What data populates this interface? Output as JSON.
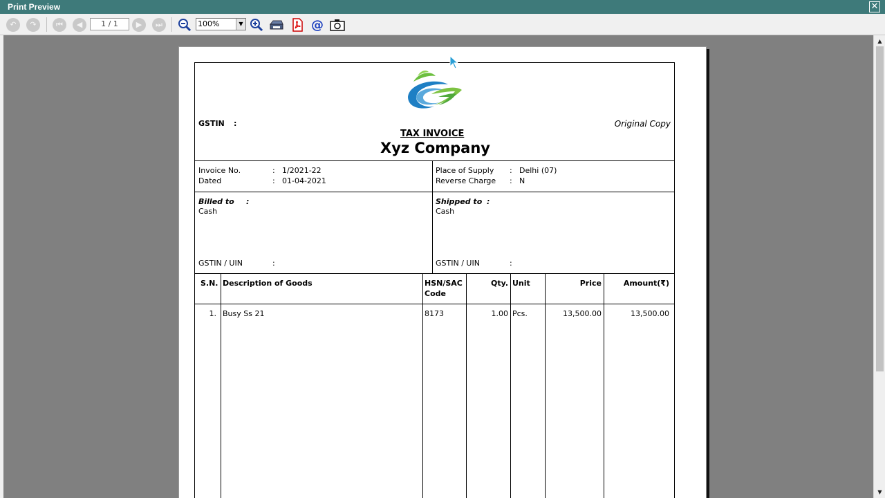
{
  "window": {
    "title": "Print Preview",
    "close_label": "✕"
  },
  "toolbar": {
    "page_indicator": "1 / 1",
    "zoom_value": "100%",
    "icons": [
      "undo-icon",
      "redo-icon",
      "first-page-icon",
      "previous-page-icon",
      "next-page-icon",
      "last-page-icon",
      "zoom-out-icon",
      "zoom-in-icon",
      "print-icon",
      "pdf-icon",
      "email-icon",
      "camera-icon"
    ]
  },
  "invoice": {
    "gstin_label": "GSTIN",
    "gstin_colon": ":",
    "copy_type": "Original Copy",
    "doc_title": "TAX INVOICE",
    "company_name": "Xyz Company",
    "invoice_no_label": "Invoice No.",
    "invoice_no": "1/2021-22",
    "dated_label": "Dated",
    "dated": "01-04-2021",
    "place_of_supply_label": "Place of Supply",
    "place_of_supply": "Delhi (07)",
    "reverse_charge_label": "Reverse Charge",
    "reverse_charge": "N",
    "colon": ":",
    "billed_to_label": "Billed to",
    "billed_to": "Cash",
    "shipped_to_label": "Shipped to",
    "shipped_to": "Cash",
    "gstin_uin_label": "GSTIN / UIN",
    "columns": {
      "sn": "S.N.",
      "description": "Description of Goods",
      "hsn_line1": "HSN/SAC",
      "hsn_line2": "Code",
      "qty": "Qty.",
      "unit": "Unit",
      "price": "Price",
      "amount": "Amount(₹)"
    },
    "items": [
      {
        "sn": "1.",
        "description": "Busy Ss 21",
        "hsn": "8173",
        "qty": "1.00",
        "unit": "Pcs.",
        "price": "13,500.00",
        "amount": "13,500.00"
      }
    ]
  },
  "colors": {
    "titlebar": "#3e7a7a",
    "workspace": "#808080",
    "logo_green": "#7dc242",
    "logo_blue": "#1e7fc4"
  }
}
